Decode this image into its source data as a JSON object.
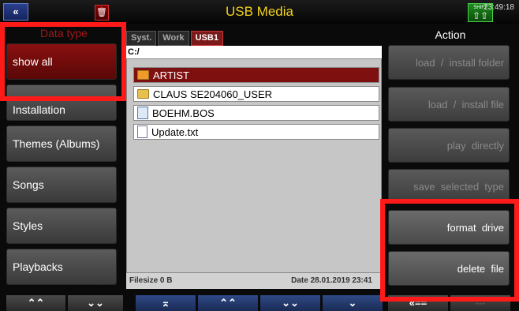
{
  "header": {
    "title": "USB Media",
    "back_icon": "«",
    "trash_icon": "🗑",
    "clock": "23:49:18",
    "shift_label": "SHIFT"
  },
  "left": {
    "header": "Data type",
    "items": [
      {
        "label": "show all",
        "active": true
      },
      {
        "label": "Installation"
      },
      {
        "label": "Themes (Albums)"
      },
      {
        "label": "Songs"
      },
      {
        "label": "Styles"
      },
      {
        "label": "Playbacks"
      }
    ]
  },
  "center": {
    "tabs": [
      "Syst.",
      "Work",
      "USB1"
    ],
    "active_tab": "USB1",
    "path": "C:/",
    "files": [
      {
        "name": "ARTIST",
        "icon": "open-folder-icon",
        "selected": true
      },
      {
        "name": "CLAUS SE204060_USER",
        "icon": "folder-icon"
      },
      {
        "name": "BOEHM.BOS",
        "icon": "bos-file-icon"
      },
      {
        "name": "Update.txt",
        "icon": "text-file-icon"
      }
    ],
    "status": {
      "filesize": "Filesize 0 B",
      "date": "Date 28.01.2019  23:41"
    }
  },
  "right": {
    "header": "Action",
    "buttons": [
      {
        "label": "load  /  install folder",
        "enabled": false
      },
      {
        "label": "load  /  install file",
        "enabled": false
      },
      {
        "label": "play  directly",
        "enabled": false
      },
      {
        "label": "save  selected  type",
        "enabled": false
      },
      {
        "label": "format  drive",
        "enabled": true
      },
      {
        "label": "delete  file",
        "enabled": true
      }
    ]
  },
  "bottom": {
    "buttons": [
      "⌃⌃",
      "⌄⌄",
      "⌅",
      "⌃⌃",
      "⌄⌄",
      "⌄",
      "«==",
      "---"
    ]
  },
  "colors": {
    "highlight": "#ff1a1a",
    "title": "#f2d21a",
    "active": "#8a1010"
  }
}
